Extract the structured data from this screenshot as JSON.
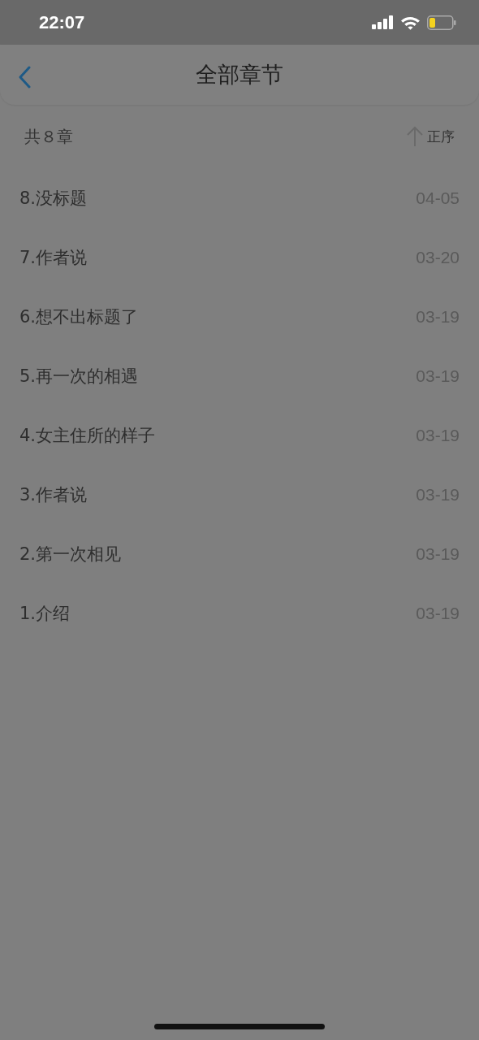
{
  "status_bar": {
    "time": "22:07"
  },
  "nav": {
    "title": "全部章节"
  },
  "summary": {
    "count": "共８章",
    "sort": "正序"
  },
  "chapters": [
    {
      "title": "8.没标题",
      "date": "04-05"
    },
    {
      "title": "7.作者说",
      "date": "03-20"
    },
    {
      "title": "6.想不出标题了",
      "date": "03-19"
    },
    {
      "title": "5.再一次的相遇",
      "date": "03-19"
    },
    {
      "title": "4.女主住所的样子",
      "date": "03-19"
    },
    {
      "title": "3.作者说",
      "date": "03-19"
    },
    {
      "title": "2.第一次相见",
      "date": "03-19"
    },
    {
      "title": "1.介绍",
      "date": "03-19"
    }
  ]
}
